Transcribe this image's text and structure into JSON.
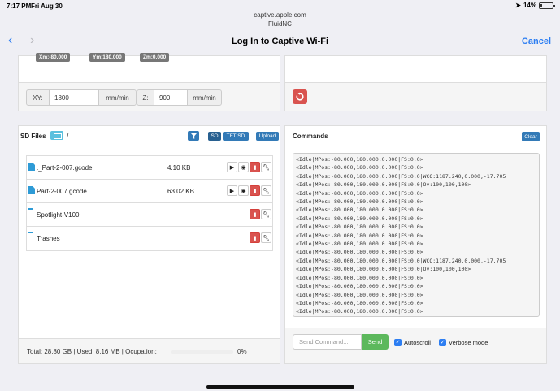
{
  "status_bar": {
    "time": "7:17 PM",
    "date": "Fri Aug 30",
    "battery": "14%",
    "battery_level": 0.14
  },
  "browser": {
    "url": "captive.apple.com",
    "subtitle": "FluidNC",
    "title": "Log In to Captive Wi-Fi",
    "cancel": "Cancel"
  },
  "position": {
    "xm": "Xm:-80.000",
    "ym": "Ym:180.000",
    "zm": "Zm:0.000"
  },
  "feedrate": {
    "xy_label": "XY:",
    "xy_value": "1800",
    "xy_unit": "mm/min",
    "z_label": "Z:",
    "z_value": "900",
    "z_unit": "mm/min"
  },
  "sd": {
    "title": "SD Files",
    "path": "/",
    "sd_button": "SD",
    "tft_button": "TFT SD",
    "upload_button": "Upload",
    "files": [
      {
        "name": "._Part-2-007.gcode",
        "size": "4.10 KB"
      },
      {
        "name": "Part-2-007.gcode",
        "size": "63.02 KB"
      }
    ],
    "folders": [
      {
        "name": "Spotlight-V100"
      },
      {
        "name": "Trashes"
      }
    ],
    "footer": "Total: 28.80 GB  |  Used: 8.16 MB  |   Ocupation:",
    "occupation": "0%",
    "occupation_value": 0
  },
  "commands": {
    "title": "Commands",
    "clear_button": "Clear",
    "lines": [
      "<Idle|MPos:-80.000,180.000,0.000|FS:0,0>",
      "<Idle|MPos:-80.000,180.000,0.000|FS:0,0>",
      "<Idle|MPos:-80.000,180.000,0.000|FS:0,0|WCO:1187.240,0.000,-17.705",
      "<Idle|MPos:-80.000,180.000,0.000|FS:0,0|Ov:100,100,100>",
      "<Idle|MPos:-80.000,180.000,0.000|FS:0,0>",
      "<Idle|MPos:-80.000,180.000,0.000|FS:0,0>",
      "<Idle|MPos:-80.000,180.000,0.000|FS:0,0>",
      "<Idle|MPos:-80.000,180.000,0.000|FS:0,0>",
      "<Idle|MPos:-80.000,180.000,0.000|FS:0,0>",
      "<Idle|MPos:-80.000,180.000,0.000|FS:0,0>",
      "<Idle|MPos:-80.000,180.000,0.000|FS:0,0>",
      "<Idle|MPos:-80.000,180.000,0.000|FS:0,0>",
      "<Idle|MPos:-80.000,180.000,0.000|FS:0,0|WCO:1187.240,0.000,-17.705",
      "<Idle|MPos:-80.000,180.000,0.000|FS:0,0|Ov:100,100,100>",
      "<Idle|MPos:-80.000,180.000,0.000|FS:0,0>",
      "<Idle|MPos:-80.000,180.000,0.000|FS:0,0>",
      "<Idle|MPos:-80.000,180.000,0.000|FS:0,0>",
      "<Idle|MPos:-80.000,180.000,0.000|FS:0,0>",
      "<Idle|MPos:-80.000,180.000,0.000|FS:0,0>"
    ],
    "send_placeholder": "Send Command...",
    "send_button": "Send",
    "autoscroll": "Autoscroll",
    "verbose": "Verbose mode"
  },
  "colors": {
    "accent": "#2d7ef2",
    "danger": "#d9534f",
    "primary": "#337ab7",
    "success": "#5cb85c",
    "info": "#5bc0de"
  }
}
